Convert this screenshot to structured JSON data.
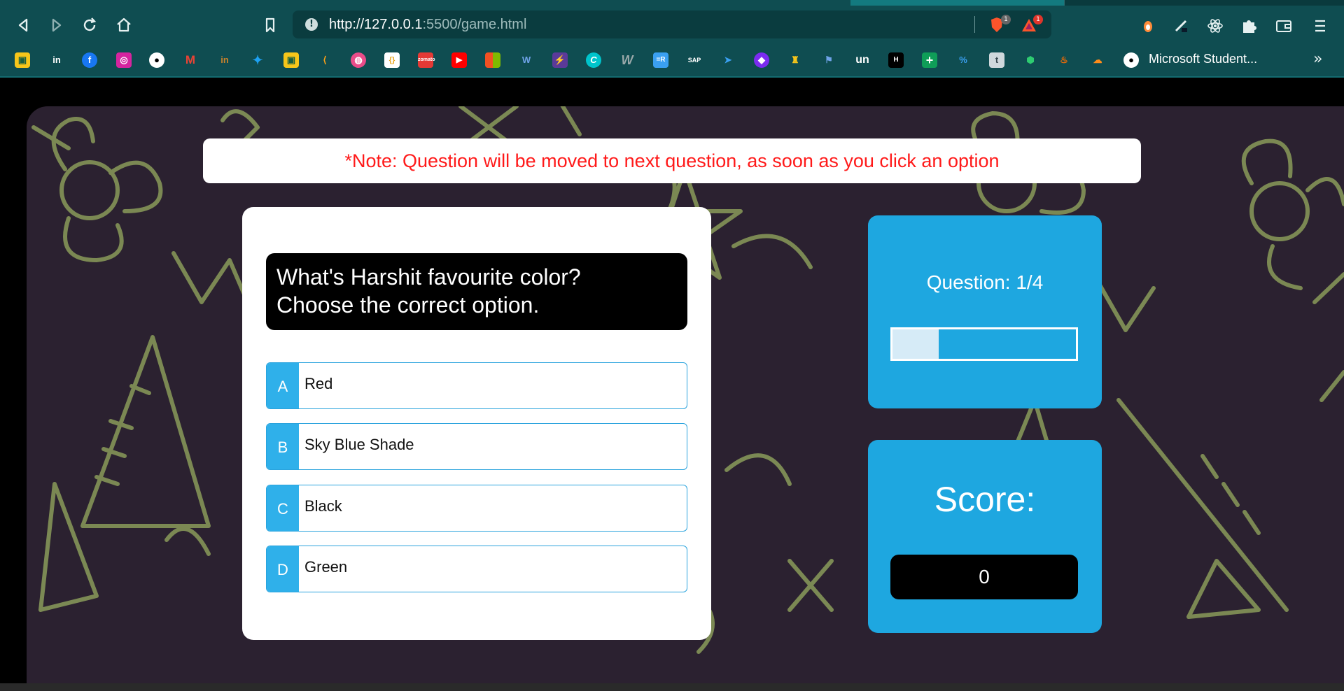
{
  "browser": {
    "url_host": "http://127.0.0.1",
    "url_path": ":5500/game.html",
    "brave_shield_count": "1",
    "brave_rewards_count": "1",
    "bookmark_label": "Microsoft Student...",
    "bookmark_more": "»"
  },
  "note": {
    "text": "*Note: Question will be moved to next question, as soon as you click an option"
  },
  "quiz": {
    "question_line1": "What's Harshit favourite color?",
    "question_line2": "Choose the correct option.",
    "options": [
      {
        "prefix": "A",
        "text": "Red"
      },
      {
        "prefix": "B",
        "text": "Sky Blue Shade"
      },
      {
        "prefix": "C",
        "text": "Black"
      },
      {
        "prefix": "D",
        "text": "Green"
      }
    ]
  },
  "hud": {
    "question_label": "Question: 1/4",
    "progress_fraction": 0.25,
    "score_label": "Score:",
    "score_value": "0"
  },
  "colors": {
    "accent": "#1ea7e0",
    "option_prefix": "#2fb0ea",
    "note_text": "#ff1a1a",
    "browser_chrome": "#0f4d51"
  }
}
